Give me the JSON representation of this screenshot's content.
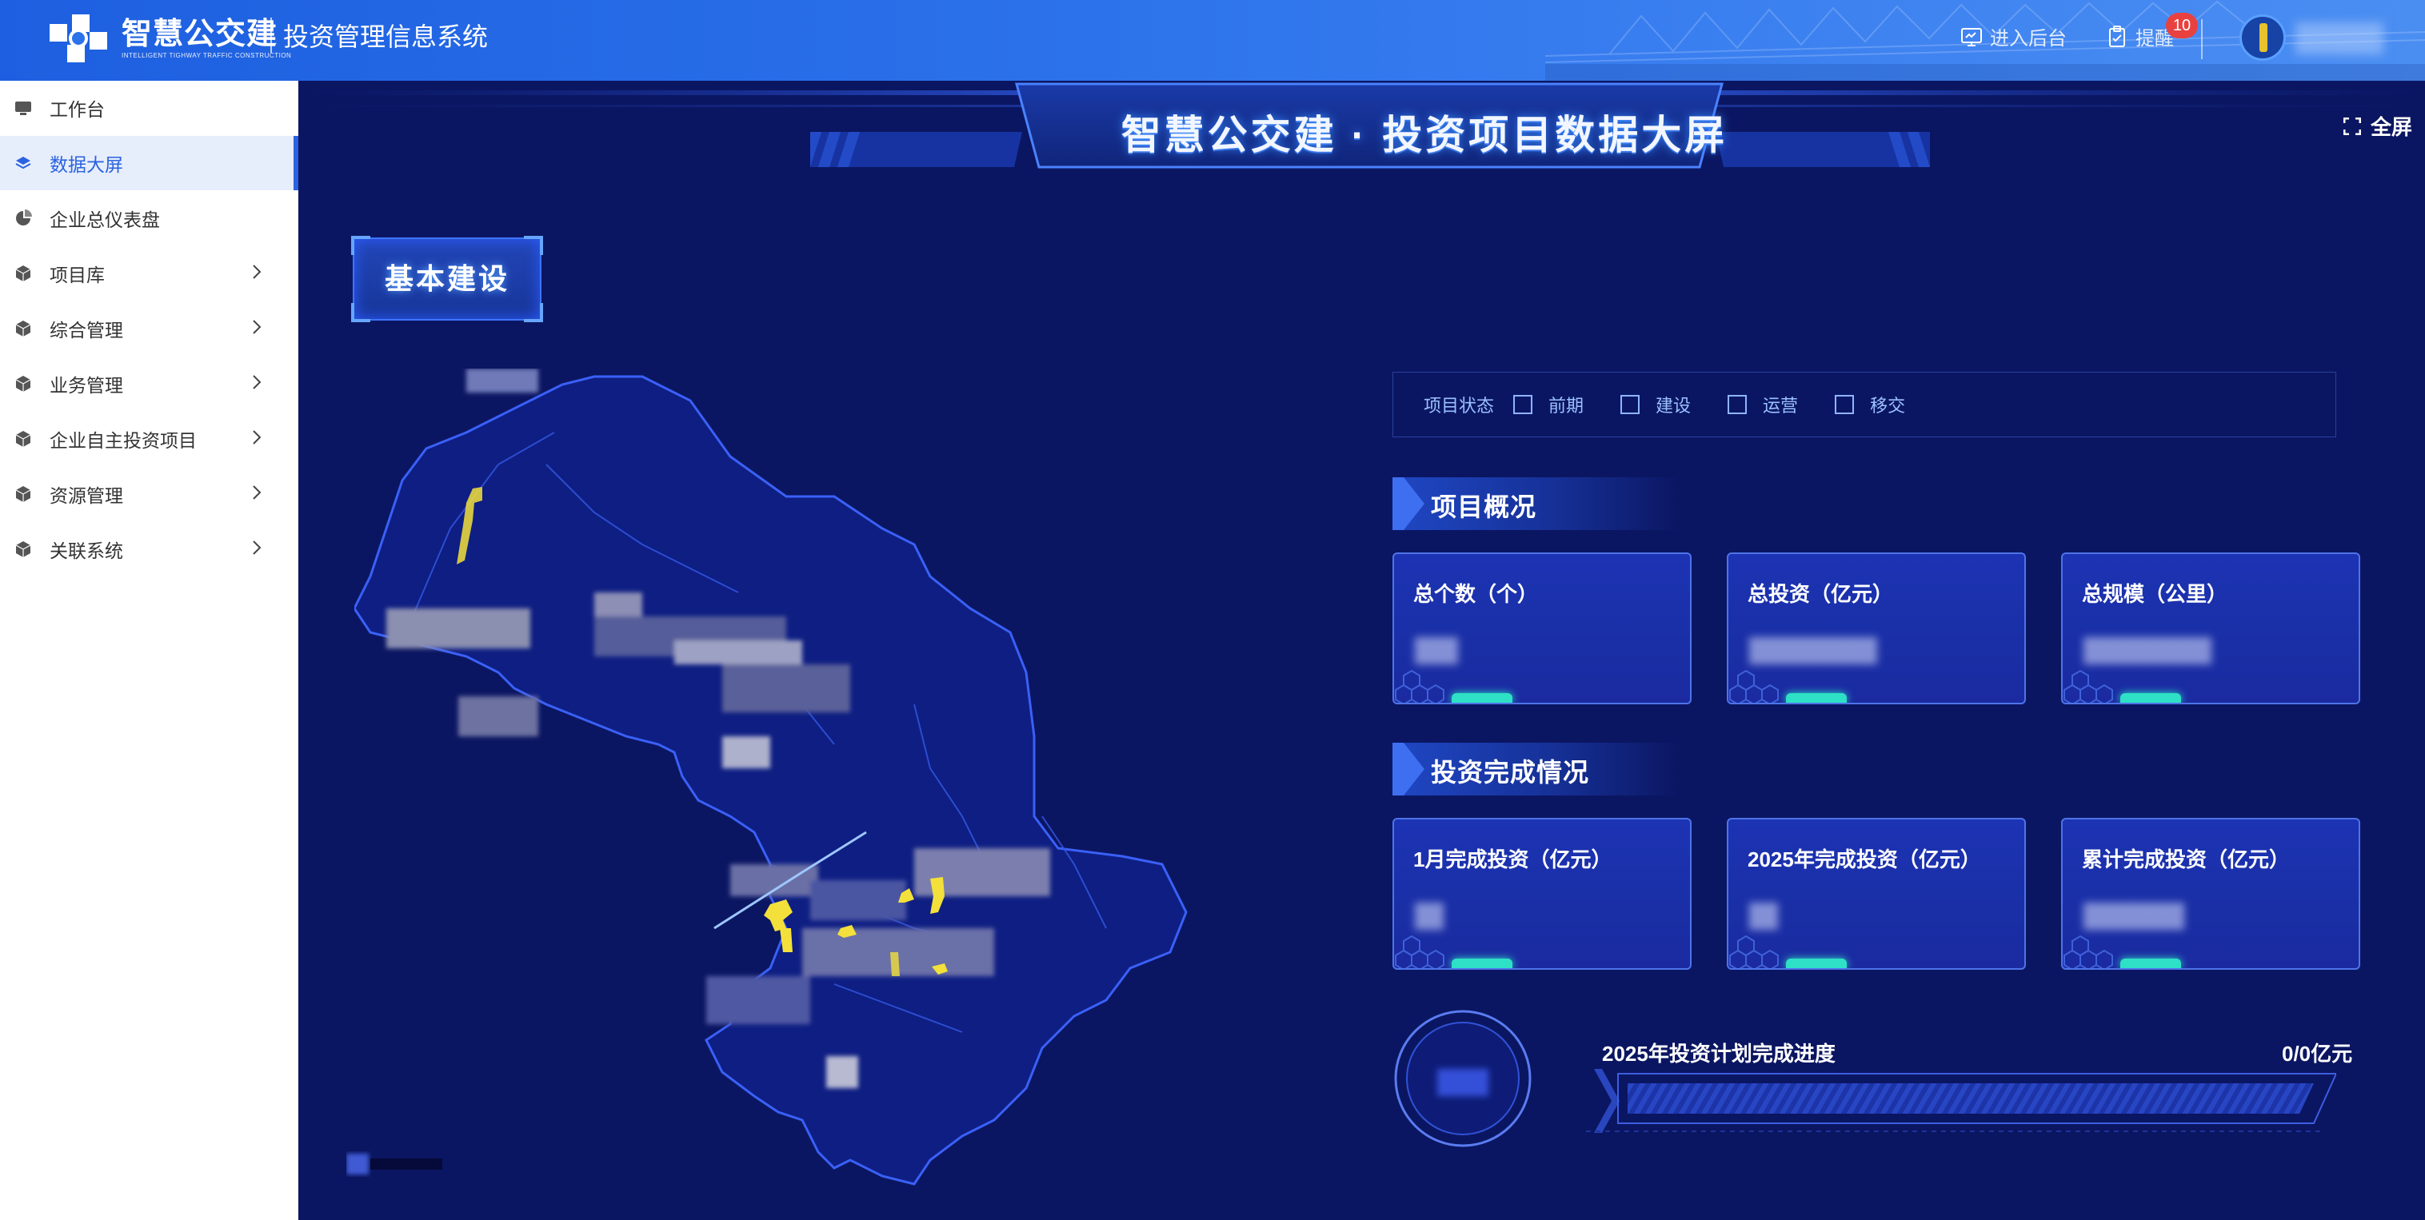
{
  "header": {
    "brand_cn": "智慧公交建",
    "brand_en": "INTELLIGENT TIGHWAY TRAFFIC CONSTRUCTION",
    "system_title": "投资管理信息系统",
    "links": [
      {
        "label": "进入后台",
        "icon": "monitor-icon"
      },
      {
        "label": "提醒",
        "icon": "clipboard-icon"
      }
    ],
    "notification_count": "10"
  },
  "sidebar": {
    "items": [
      {
        "label": "工作台",
        "icon": "monitor-icon",
        "has_children": false,
        "active": false
      },
      {
        "label": "数据大屏",
        "icon": "layers-icon",
        "has_children": false,
        "active": true
      },
      {
        "label": "企业总仪表盘",
        "icon": "pie-icon",
        "has_children": false,
        "active": false
      },
      {
        "label": "项目库",
        "icon": "cube-icon",
        "has_children": true,
        "active": false
      },
      {
        "label": "综合管理",
        "icon": "cube-icon",
        "has_children": true,
        "active": false
      },
      {
        "label": "业务管理",
        "icon": "cube-icon",
        "has_children": true,
        "active": false
      },
      {
        "label": "企业自主投资项目",
        "icon": "cube-icon",
        "has_children": true,
        "active": false
      },
      {
        "label": "资源管理",
        "icon": "cube-icon",
        "has_children": true,
        "active": false
      },
      {
        "label": "关联系统",
        "icon": "cube-icon",
        "has_children": true,
        "active": false
      }
    ]
  },
  "screen": {
    "title": "智慧公交建 · 投资项目数据大屏",
    "fullscreen_label": "全屏",
    "category_button": "基本建设",
    "filter": {
      "label": "项目状态",
      "options": [
        "前期",
        "建设",
        "运营",
        "移交"
      ]
    },
    "overview": {
      "title": "项目概况",
      "cards": [
        {
          "label": "总个数（个）"
        },
        {
          "label": "总投资（亿元）"
        },
        {
          "label": "总规模（公里）"
        }
      ]
    },
    "investment": {
      "title": "投资完成情况",
      "cards": [
        {
          "label": "1月完成投资（亿元）"
        },
        {
          "label": "2025年完成投资（亿元）"
        },
        {
          "label": "累计完成投资（亿元）"
        }
      ]
    },
    "progress": {
      "label": "2025年投资计划完成进度",
      "value": "0/0亿元",
      "fraction": 0
    }
  },
  "colors": {
    "topbar": "#2c72ea",
    "screen_bg": "#0b1662",
    "card_bg": "#1c33b4",
    "card_accent": "#2ee0c6",
    "highlight": "#f3e03a",
    "active_nav": "#2b62e0"
  }
}
